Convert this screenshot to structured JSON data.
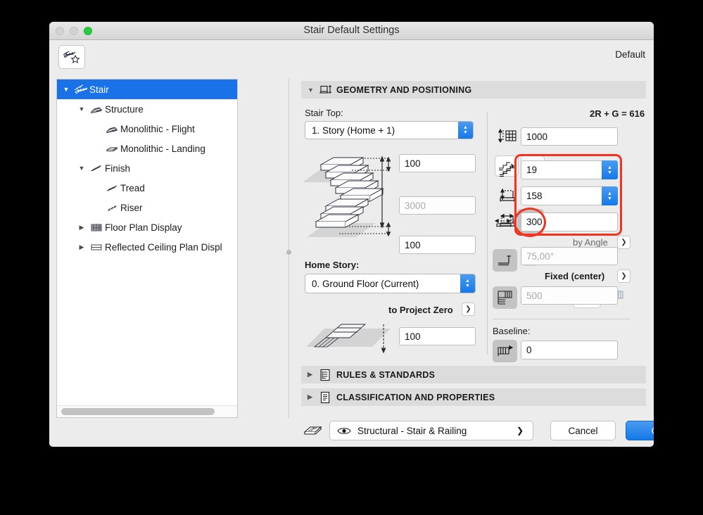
{
  "window": {
    "title": "Stair Default Settings",
    "traffic_lights": [
      "close-button",
      "minimize-button",
      "zoom-button"
    ],
    "accent_blue": "#1479e8",
    "selection_blue": "#1a72e8",
    "annotation_red": "#f4321f"
  },
  "toolbar": {
    "favorites_icon": "stair-favorite-icon",
    "default_label": "Default"
  },
  "sidebar": {
    "items": [
      {
        "label": "Stair",
        "indent": 0,
        "twisty": "down",
        "icon": "stair-icon",
        "selected": true
      },
      {
        "label": "Structure",
        "indent": 1,
        "twisty": "down",
        "icon": "structure-icon",
        "selected": false
      },
      {
        "label": "Monolithic - Flight",
        "indent": 2,
        "twisty": "none",
        "icon": "flight-icon",
        "selected": false
      },
      {
        "label": "Monolithic - Landing",
        "indent": 2,
        "twisty": "none",
        "icon": "landing-icon",
        "selected": false
      },
      {
        "label": "Finish",
        "indent": 1,
        "twisty": "down",
        "icon": "finish-icon",
        "selected": false
      },
      {
        "label": "Tread",
        "indent": 2,
        "twisty": "none",
        "icon": "tread-icon",
        "selected": false
      },
      {
        "label": "Riser",
        "indent": 2,
        "twisty": "none",
        "icon": "riser-icon",
        "selected": false
      },
      {
        "label": "Floor Plan Display",
        "indent": 1,
        "twisty": "right",
        "icon": "floor-plan-icon",
        "selected": false
      },
      {
        "label": "Reflected Ceiling Plan Displ",
        "indent": 1,
        "twisty": "right",
        "icon": "ceiling-plan-icon",
        "selected": false
      }
    ]
  },
  "sections": [
    {
      "id": "geometry",
      "label": "GEOMETRY AND POSITIONING",
      "icon": "geometry-icon",
      "expanded": true
    },
    {
      "id": "rules",
      "label": "RULES & STANDARDS",
      "icon": "rules-icon",
      "expanded": false
    },
    {
      "id": "classification",
      "label": "CLASSIFICATION AND PROPERTIES",
      "icon": "classification-icon",
      "expanded": false
    }
  ],
  "geometry": {
    "stair_top_label": "Stair Top:",
    "stair_top_value": "1. Story (Home + 1)",
    "home_story_label": "Home Story:",
    "home_story_value": "0. Ground Floor (Current)",
    "to_project_zero_label": "to Project Zero",
    "top_offset_value": "100",
    "total_height_value": "3000",
    "bottom_offset_value": "100",
    "project_zero_value": "100",
    "formula_label": "2R + G = 616",
    "total_rise_value": "1000",
    "total_rise_icon": "total-height-icon",
    "riser_count_value": "19",
    "riser_count_icon": "riser-count-icon",
    "riser_height_value": "158",
    "riser_height_icon": "riser-height-icon",
    "tread_depth_value": "300",
    "tread_depth_icon": "tread-depth-icon",
    "by_angle_label": "by Angle",
    "angle_value": "75,00°",
    "angle_icon": "angle-icon",
    "fixed_center_label": "Fixed (center)",
    "walking_line_value": "500",
    "baseline_label": "Baseline:",
    "baseline_offset_value": "0",
    "flight_buttons": [
      "flight-type-icon",
      "slant-type-icon"
    ],
    "width_buttons": [
      "width-free-icon",
      "width-locked-icon"
    ],
    "tread_buttons": [
      "tread-flat-icon",
      "tread-angle-icon"
    ],
    "winder_buttons": [
      "winder-none-icon",
      "winder-balanced-icon",
      "winder-radial-icon",
      "winder-settings-icon",
      "winder-preview-icon"
    ],
    "baseline_buttons": [
      "baseline-left-icon",
      "baseline-center-icon",
      "baseline-right-icon"
    ],
    "baseline_offset_icon": "baseline-offset-icon"
  },
  "footer": {
    "favorites_icon": "layers-icon",
    "pen_eye_icon": "eye-icon",
    "pen_label": "Structural - Stair & Railing",
    "cancel_label": "Cancel",
    "ok_label": "OK"
  }
}
